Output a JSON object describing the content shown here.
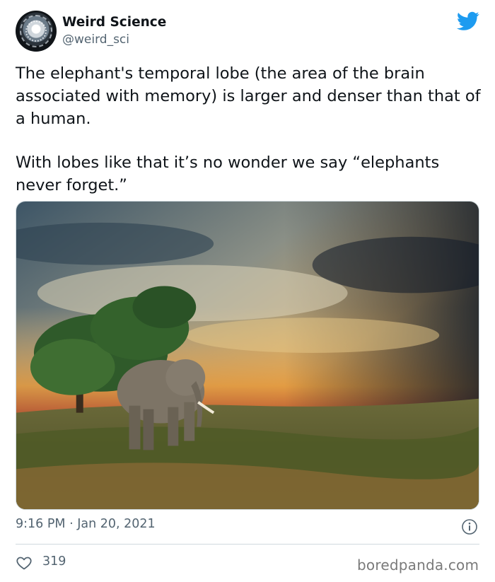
{
  "author": {
    "display_name": "Weird Science",
    "handle": "@weird_sci",
    "avatar_icon": "tunnel-avatar"
  },
  "platform_icon": "twitter-bird-icon",
  "colors": {
    "twitter_blue": "#1d9bf0",
    "secondary_text": "#536471",
    "primary_text": "#0f1419"
  },
  "tweet": {
    "paragraph_1": "The elephant's temporal lobe (the area of the brain associated with memory) is larger and denser than that of a human.",
    "paragraph_2": "With lobes like that it’s no wonder we say “elephants never forget.”",
    "image_icon": "elephant-savanna-photo"
  },
  "meta": {
    "timestamp": "9:16 PM · Jan 20, 2021",
    "likes": "319"
  },
  "watermark": "boredpanda.com"
}
